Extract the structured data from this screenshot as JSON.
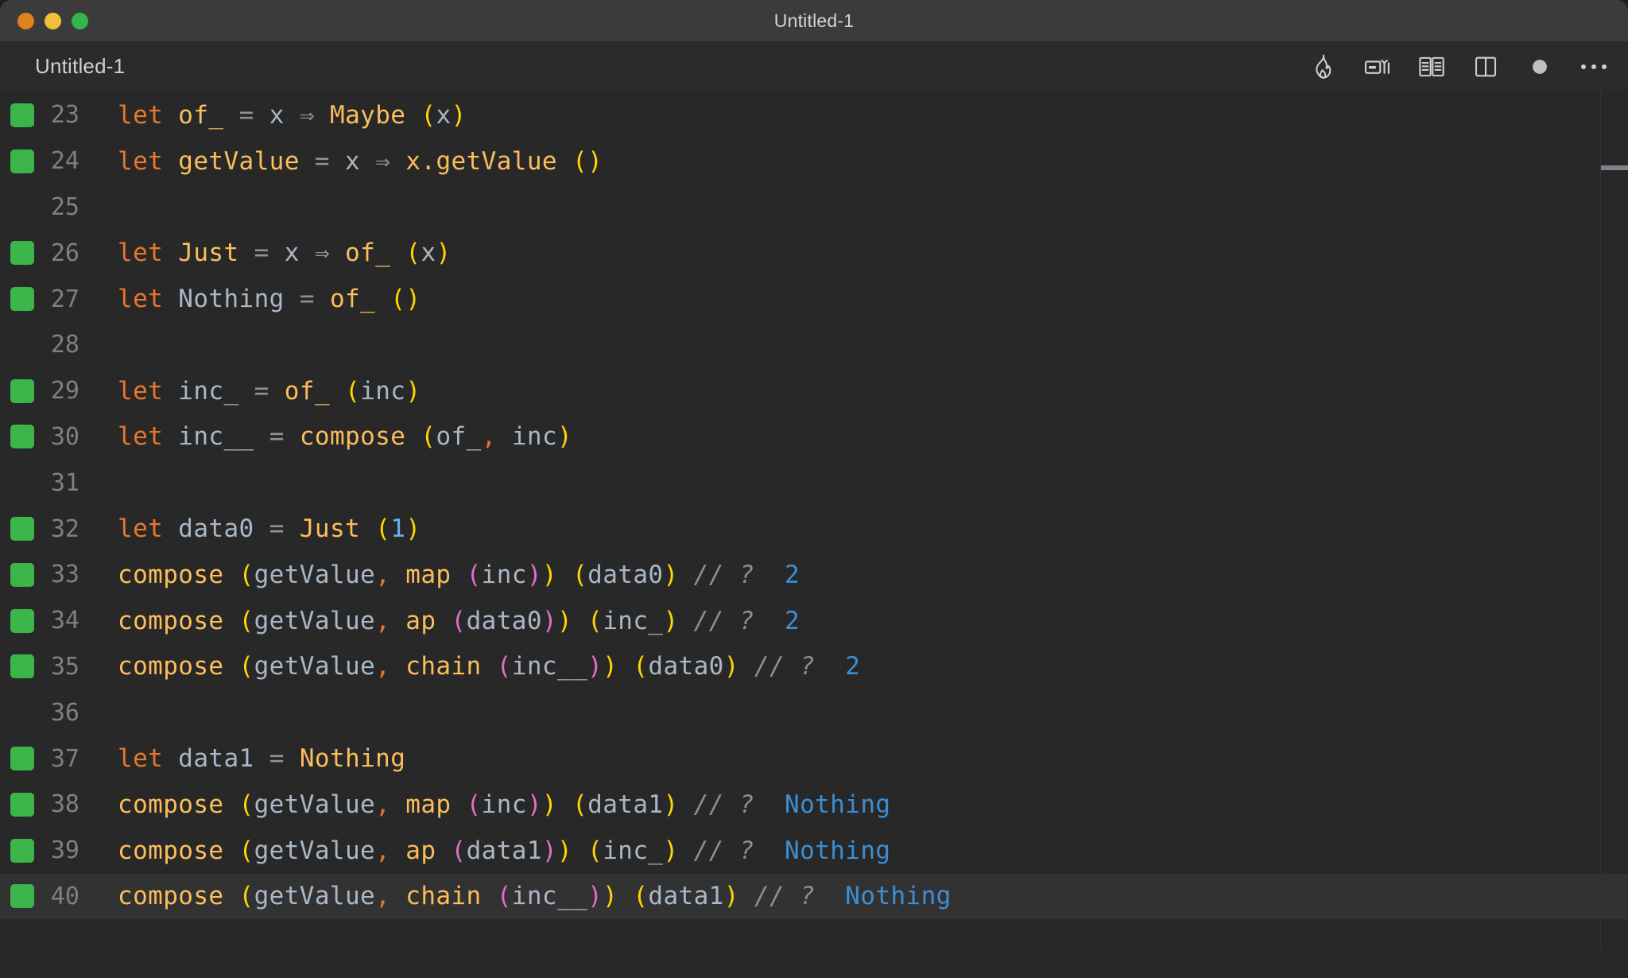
{
  "window": {
    "title": "Untitled-1",
    "traffic_lights": [
      {
        "name": "close",
        "color": "#e0811f"
      },
      {
        "name": "minimize",
        "color": "#f3c03a"
      },
      {
        "name": "maximize",
        "color": "#31b64c"
      }
    ]
  },
  "tab": {
    "label": "Untitled-1"
  },
  "toolbar": {
    "buttons": [
      {
        "icon": "flame-icon",
        "label": "Run / Quokka"
      },
      {
        "icon": "code-preview-icon",
        "label": "Open Preview"
      },
      {
        "icon": "book-icon",
        "label": "Open Documentation"
      },
      {
        "icon": "split-editor-icon",
        "label": "Split Editor"
      },
      {
        "icon": "record-dot-icon",
        "label": "Record"
      },
      {
        "icon": "more-actions-icon",
        "label": "More Actions..."
      }
    ]
  },
  "editor": {
    "active_line": 40,
    "gutter_marker_color": "#3bb54a",
    "colors": {
      "background": "#282828",
      "active_line": "#323232",
      "keyword": "#e8762c",
      "function": "#fbbe5b",
      "variable": "#a9b7c6",
      "operator": "#8f9396",
      "paren_level1": "#ffd700",
      "paren_level2": "#e06ecb",
      "comment": "#8a8f92",
      "result": "#3b8fd4",
      "number": "#6ab0f3",
      "line_number": "#7c8184"
    },
    "lines": [
      {
        "n": "23",
        "marker": true,
        "tokens": [
          {
            "t": "let",
            "c": "kw"
          },
          {
            "t": " ",
            "c": "var"
          },
          {
            "t": "of_",
            "c": "fn"
          },
          {
            "t": " ",
            "c": "var"
          },
          {
            "t": "=",
            "c": "op"
          },
          {
            "t": " ",
            "c": "var"
          },
          {
            "t": "x",
            "c": "var"
          },
          {
            "t": " ",
            "c": "var"
          },
          {
            "t": "⇒",
            "c": "op"
          },
          {
            "t": " ",
            "c": "var"
          },
          {
            "t": "Maybe",
            "c": "fn"
          },
          {
            "t": " ",
            "c": "var"
          },
          {
            "t": "(",
            "c": "punct-y"
          },
          {
            "t": "x",
            "c": "var"
          },
          {
            "t": ")",
            "c": "punct-y"
          }
        ]
      },
      {
        "n": "24",
        "marker": true,
        "tokens": [
          {
            "t": "let",
            "c": "kw"
          },
          {
            "t": " ",
            "c": "var"
          },
          {
            "t": "getValue",
            "c": "fn"
          },
          {
            "t": " ",
            "c": "var"
          },
          {
            "t": "=",
            "c": "op"
          },
          {
            "t": " ",
            "c": "var"
          },
          {
            "t": "x",
            "c": "var"
          },
          {
            "t": " ",
            "c": "var"
          },
          {
            "t": "⇒",
            "c": "op"
          },
          {
            "t": " ",
            "c": "var"
          },
          {
            "t": "x.getValue",
            "c": "fn"
          },
          {
            "t": " ",
            "c": "var"
          },
          {
            "t": "(",
            "c": "punct-y"
          },
          {
            "t": ")",
            "c": "punct-y"
          }
        ]
      },
      {
        "n": "25",
        "marker": false,
        "tokens": []
      },
      {
        "n": "26",
        "marker": true,
        "tokens": [
          {
            "t": "let",
            "c": "kw"
          },
          {
            "t": " ",
            "c": "var"
          },
          {
            "t": "Just",
            "c": "fn"
          },
          {
            "t": " ",
            "c": "var"
          },
          {
            "t": "=",
            "c": "op"
          },
          {
            "t": " ",
            "c": "var"
          },
          {
            "t": "x",
            "c": "var"
          },
          {
            "t": " ",
            "c": "var"
          },
          {
            "t": "⇒",
            "c": "op"
          },
          {
            "t": " ",
            "c": "var"
          },
          {
            "t": "of_",
            "c": "fn"
          },
          {
            "t": " ",
            "c": "var"
          },
          {
            "t": "(",
            "c": "punct-y"
          },
          {
            "t": "x",
            "c": "var"
          },
          {
            "t": ")",
            "c": "punct-y"
          }
        ]
      },
      {
        "n": "27",
        "marker": true,
        "tokens": [
          {
            "t": "let",
            "c": "kw"
          },
          {
            "t": " ",
            "c": "var"
          },
          {
            "t": "Nothing",
            "c": "var"
          },
          {
            "t": " ",
            "c": "var"
          },
          {
            "t": "=",
            "c": "op"
          },
          {
            "t": " ",
            "c": "var"
          },
          {
            "t": "of_",
            "c": "fn"
          },
          {
            "t": " ",
            "c": "var"
          },
          {
            "t": "(",
            "c": "punct-y"
          },
          {
            "t": ")",
            "c": "punct-y"
          }
        ]
      },
      {
        "n": "28",
        "marker": false,
        "tokens": []
      },
      {
        "n": "29",
        "marker": true,
        "tokens": [
          {
            "t": "let",
            "c": "kw"
          },
          {
            "t": " ",
            "c": "var"
          },
          {
            "t": "inc_",
            "c": "var"
          },
          {
            "t": " ",
            "c": "var"
          },
          {
            "t": "=",
            "c": "op"
          },
          {
            "t": " ",
            "c": "var"
          },
          {
            "t": "of_",
            "c": "fn"
          },
          {
            "t": " ",
            "c": "var"
          },
          {
            "t": "(",
            "c": "punct-y"
          },
          {
            "t": "inc",
            "c": "var"
          },
          {
            "t": ")",
            "c": "punct-y"
          }
        ]
      },
      {
        "n": "30",
        "marker": true,
        "tokens": [
          {
            "t": "let",
            "c": "kw"
          },
          {
            "t": " ",
            "c": "var"
          },
          {
            "t": "inc__",
            "c": "var"
          },
          {
            "t": " ",
            "c": "var"
          },
          {
            "t": "=",
            "c": "op"
          },
          {
            "t": " ",
            "c": "var"
          },
          {
            "t": "compose",
            "c": "fn"
          },
          {
            "t": " ",
            "c": "var"
          },
          {
            "t": "(",
            "c": "punct-y"
          },
          {
            "t": "of_",
            "c": "var"
          },
          {
            "t": ",",
            "c": "comma"
          },
          {
            "t": " ",
            "c": "var"
          },
          {
            "t": "inc",
            "c": "var"
          },
          {
            "t": ")",
            "c": "punct-y"
          }
        ]
      },
      {
        "n": "31",
        "marker": false,
        "tokens": []
      },
      {
        "n": "32",
        "marker": true,
        "tokens": [
          {
            "t": "let",
            "c": "kw"
          },
          {
            "t": " ",
            "c": "var"
          },
          {
            "t": "data0",
            "c": "var"
          },
          {
            "t": " ",
            "c": "var"
          },
          {
            "t": "=",
            "c": "op"
          },
          {
            "t": " ",
            "c": "var"
          },
          {
            "t": "Just",
            "c": "fn"
          },
          {
            "t": " ",
            "c": "var"
          },
          {
            "t": "(",
            "c": "punct-y"
          },
          {
            "t": "1",
            "c": "num"
          },
          {
            "t": ")",
            "c": "punct-y"
          }
        ]
      },
      {
        "n": "33",
        "marker": true,
        "tokens": [
          {
            "t": "compose",
            "c": "fn"
          },
          {
            "t": " ",
            "c": "var"
          },
          {
            "t": "(",
            "c": "punct-y"
          },
          {
            "t": "getValue",
            "c": "var"
          },
          {
            "t": ",",
            "c": "comma"
          },
          {
            "t": " ",
            "c": "var"
          },
          {
            "t": "map",
            "c": "fn"
          },
          {
            "t": " ",
            "c": "var"
          },
          {
            "t": "(",
            "c": "punct-m"
          },
          {
            "t": "inc",
            "c": "var"
          },
          {
            "t": ")",
            "c": "punct-m"
          },
          {
            "t": ")",
            "c": "punct-y"
          },
          {
            "t": " ",
            "c": "var"
          },
          {
            "t": "(",
            "c": "punct-y"
          },
          {
            "t": "data0",
            "c": "var"
          },
          {
            "t": ")",
            "c": "punct-y"
          },
          {
            "t": " ",
            "c": "var"
          },
          {
            "t": "// ?",
            "c": "cmt"
          },
          {
            "t": "  ",
            "c": "var"
          },
          {
            "t": "2",
            "c": "res"
          }
        ]
      },
      {
        "n": "34",
        "marker": true,
        "tokens": [
          {
            "t": "compose",
            "c": "fn"
          },
          {
            "t": " ",
            "c": "var"
          },
          {
            "t": "(",
            "c": "punct-y"
          },
          {
            "t": "getValue",
            "c": "var"
          },
          {
            "t": ",",
            "c": "comma"
          },
          {
            "t": " ",
            "c": "var"
          },
          {
            "t": "ap",
            "c": "fn"
          },
          {
            "t": " ",
            "c": "var"
          },
          {
            "t": "(",
            "c": "punct-m"
          },
          {
            "t": "data0",
            "c": "var"
          },
          {
            "t": ")",
            "c": "punct-m"
          },
          {
            "t": ")",
            "c": "punct-y"
          },
          {
            "t": " ",
            "c": "var"
          },
          {
            "t": "(",
            "c": "punct-y"
          },
          {
            "t": "inc_",
            "c": "var"
          },
          {
            "t": ")",
            "c": "punct-y"
          },
          {
            "t": " ",
            "c": "var"
          },
          {
            "t": "// ?",
            "c": "cmt"
          },
          {
            "t": "  ",
            "c": "var"
          },
          {
            "t": "2",
            "c": "res"
          }
        ]
      },
      {
        "n": "35",
        "marker": true,
        "tokens": [
          {
            "t": "compose",
            "c": "fn"
          },
          {
            "t": " ",
            "c": "var"
          },
          {
            "t": "(",
            "c": "punct-y"
          },
          {
            "t": "getValue",
            "c": "var"
          },
          {
            "t": ",",
            "c": "comma"
          },
          {
            "t": " ",
            "c": "var"
          },
          {
            "t": "chain",
            "c": "fn"
          },
          {
            "t": " ",
            "c": "var"
          },
          {
            "t": "(",
            "c": "punct-m"
          },
          {
            "t": "inc__",
            "c": "var"
          },
          {
            "t": ")",
            "c": "punct-m"
          },
          {
            "t": ")",
            "c": "punct-y"
          },
          {
            "t": " ",
            "c": "var"
          },
          {
            "t": "(",
            "c": "punct-y"
          },
          {
            "t": "data0",
            "c": "var"
          },
          {
            "t": ")",
            "c": "punct-y"
          },
          {
            "t": " ",
            "c": "var"
          },
          {
            "t": "// ?",
            "c": "cmt"
          },
          {
            "t": "  ",
            "c": "var"
          },
          {
            "t": "2",
            "c": "res"
          }
        ]
      },
      {
        "n": "36",
        "marker": false,
        "tokens": []
      },
      {
        "n": "37",
        "marker": true,
        "tokens": [
          {
            "t": "let",
            "c": "kw"
          },
          {
            "t": " ",
            "c": "var"
          },
          {
            "t": "data1",
            "c": "var"
          },
          {
            "t": " ",
            "c": "var"
          },
          {
            "t": "=",
            "c": "op"
          },
          {
            "t": " ",
            "c": "var"
          },
          {
            "t": "Nothing",
            "c": "fn"
          }
        ]
      },
      {
        "n": "38",
        "marker": true,
        "tokens": [
          {
            "t": "compose",
            "c": "fn"
          },
          {
            "t": " ",
            "c": "var"
          },
          {
            "t": "(",
            "c": "punct-y"
          },
          {
            "t": "getValue",
            "c": "var"
          },
          {
            "t": ",",
            "c": "comma"
          },
          {
            "t": " ",
            "c": "var"
          },
          {
            "t": "map",
            "c": "fn"
          },
          {
            "t": " ",
            "c": "var"
          },
          {
            "t": "(",
            "c": "punct-m"
          },
          {
            "t": "inc",
            "c": "var"
          },
          {
            "t": ")",
            "c": "punct-m"
          },
          {
            "t": ")",
            "c": "punct-y"
          },
          {
            "t": " ",
            "c": "var"
          },
          {
            "t": "(",
            "c": "punct-y"
          },
          {
            "t": "data1",
            "c": "var"
          },
          {
            "t": ")",
            "c": "punct-y"
          },
          {
            "t": " ",
            "c": "var"
          },
          {
            "t": "// ?",
            "c": "cmt"
          },
          {
            "t": "  ",
            "c": "var"
          },
          {
            "t": "Nothing",
            "c": "res"
          }
        ]
      },
      {
        "n": "39",
        "marker": true,
        "tokens": [
          {
            "t": "compose",
            "c": "fn"
          },
          {
            "t": " ",
            "c": "var"
          },
          {
            "t": "(",
            "c": "punct-y"
          },
          {
            "t": "getValue",
            "c": "var"
          },
          {
            "t": ",",
            "c": "comma"
          },
          {
            "t": " ",
            "c": "var"
          },
          {
            "t": "ap",
            "c": "fn"
          },
          {
            "t": " ",
            "c": "var"
          },
          {
            "t": "(",
            "c": "punct-m"
          },
          {
            "t": "data1",
            "c": "var"
          },
          {
            "t": ")",
            "c": "punct-m"
          },
          {
            "t": ")",
            "c": "punct-y"
          },
          {
            "t": " ",
            "c": "var"
          },
          {
            "t": "(",
            "c": "punct-y"
          },
          {
            "t": "inc_",
            "c": "var"
          },
          {
            "t": ")",
            "c": "punct-y"
          },
          {
            "t": " ",
            "c": "var"
          },
          {
            "t": "// ?",
            "c": "cmt"
          },
          {
            "t": "  ",
            "c": "var"
          },
          {
            "t": "Nothing",
            "c": "res"
          }
        ]
      },
      {
        "n": "40",
        "marker": true,
        "active": true,
        "tokens": [
          {
            "t": "compose",
            "c": "fn"
          },
          {
            "t": " ",
            "c": "var"
          },
          {
            "t": "(",
            "c": "punct-y"
          },
          {
            "t": "getValue",
            "c": "var"
          },
          {
            "t": ",",
            "c": "comma"
          },
          {
            "t": " ",
            "c": "var"
          },
          {
            "t": "chain",
            "c": "fn"
          },
          {
            "t": " ",
            "c": "var"
          },
          {
            "t": "(",
            "c": "punct-m"
          },
          {
            "t": "inc__",
            "c": "var"
          },
          {
            "t": ")",
            "c": "punct-m"
          },
          {
            "t": ")",
            "c": "punct-y"
          },
          {
            "t": " ",
            "c": "var"
          },
          {
            "t": "(",
            "c": "punct-y"
          },
          {
            "t": "data1",
            "c": "var"
          },
          {
            "t": ")",
            "c": "punct-y"
          },
          {
            "t": " ",
            "c": "var"
          },
          {
            "t": "// ?",
            "c": "cmt"
          },
          {
            "t": "  ",
            "c": "var"
          },
          {
            "t": "Nothing",
            "c": "res"
          }
        ]
      }
    ]
  }
}
